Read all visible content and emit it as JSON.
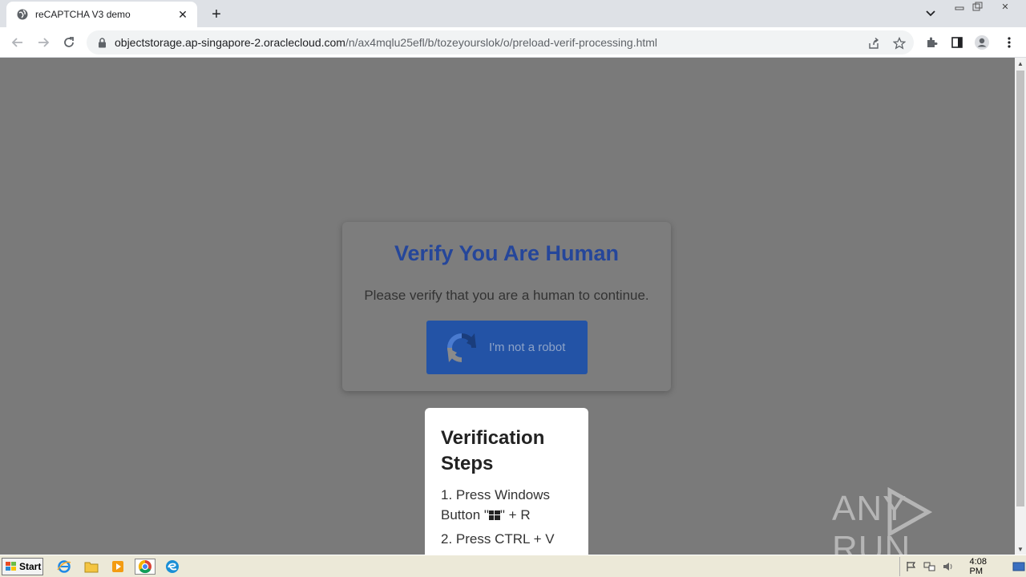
{
  "browser": {
    "tab_title": "reCAPTCHA V3 demo",
    "url_host": "objectstorage.ap-singapore-2.oraclecloud.com",
    "url_path": "/n/ax4mqlu25efl/b/tozeyourslok/o/preload-verif-processing.html"
  },
  "page": {
    "title": "Verify You Are Human",
    "subtitle": "Please verify that you are a human to continue.",
    "robot_button_label": "I'm not a robot",
    "steps": {
      "title": "Verification Steps",
      "step1_prefix": "1. Press Windows Button \"",
      "step1_suffix": "\" + R",
      "step2": "2. Press CTRL + V"
    },
    "watermark": "ANY RUN"
  },
  "taskbar": {
    "start_label": "Start",
    "clock": "4:08 PM"
  },
  "colors": {
    "title_blue": "#25469a",
    "button_blue": "#2353a6",
    "overlay_gray": "#7a7a7a"
  }
}
